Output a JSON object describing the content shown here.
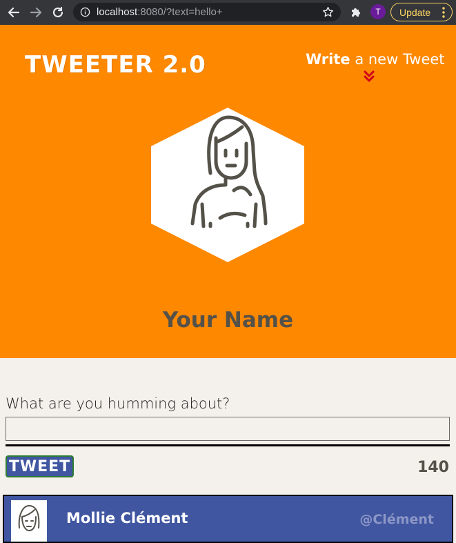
{
  "browser": {
    "url_host": "localhost",
    "url_rest": ":8080/?text=hello+",
    "profile_initial": "T",
    "update_label": "Update"
  },
  "header": {
    "brand": "TWEETER 2.0",
    "write_bold": "Write",
    "write_rest": " a new Tweet",
    "profile_name": "Your Name"
  },
  "compose": {
    "label": "What are you humming about?",
    "input_value": "",
    "tweet_button": "TWEET",
    "counter": "140"
  },
  "tweets": [
    {
      "author": "Mollie Clément",
      "handle": "@Clément"
    }
  ],
  "colors": {
    "hero": "#fe8800",
    "tweet_button": "#4056a1",
    "counter": "#545149"
  }
}
